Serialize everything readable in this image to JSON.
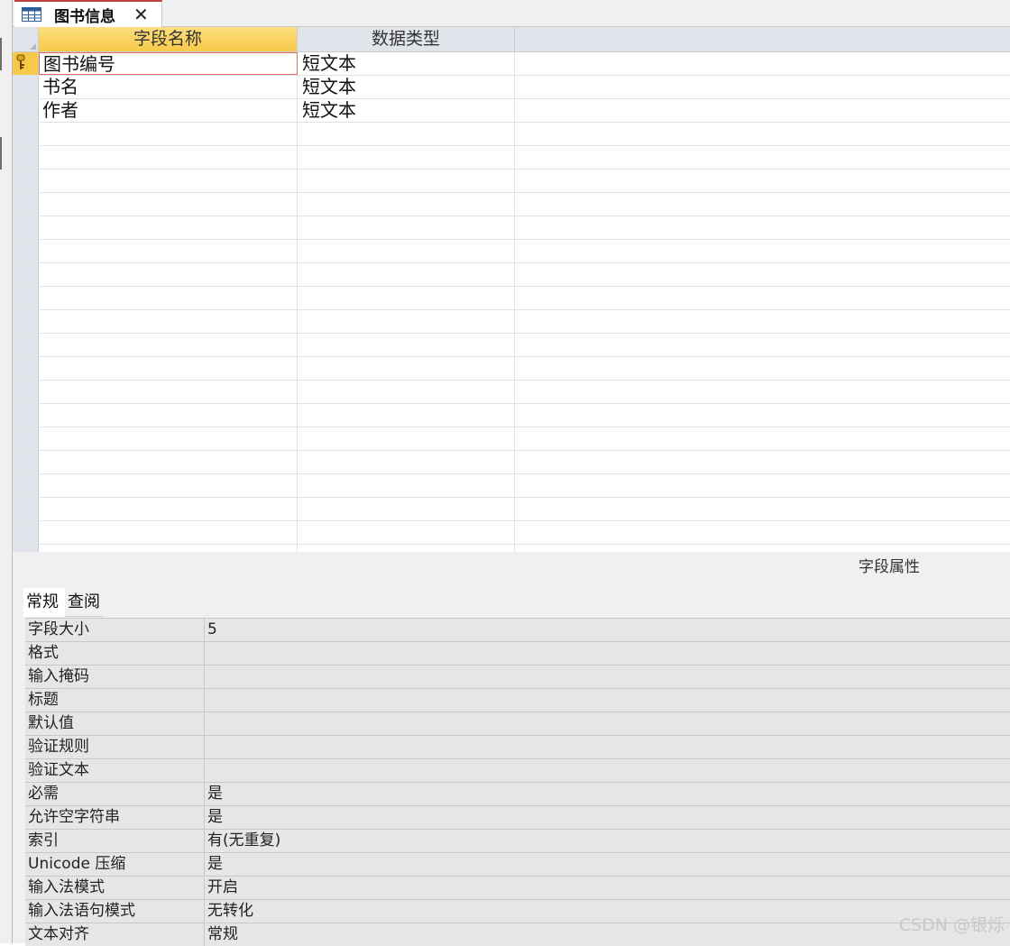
{
  "tab": {
    "title": "图书信息",
    "close_glyph": "✕"
  },
  "grid": {
    "headers": {
      "field_name": "字段名称",
      "data_type": "数据类型"
    },
    "rows": [
      {
        "name": "图书编号",
        "type": "短文本",
        "primary_key": true
      },
      {
        "name": "书名",
        "type": "短文本"
      },
      {
        "name": "作者",
        "type": "短文本"
      }
    ],
    "empty_row_count": 19
  },
  "field_properties": {
    "title": "字段属性",
    "tabs": [
      {
        "label": "常规",
        "active": true
      },
      {
        "label": "查阅",
        "active": false
      }
    ],
    "rows": [
      {
        "label": "字段大小",
        "value": "5"
      },
      {
        "label": "格式",
        "value": ""
      },
      {
        "label": "输入掩码",
        "value": ""
      },
      {
        "label": "标题",
        "value": ""
      },
      {
        "label": "默认值",
        "value": ""
      },
      {
        "label": "验证规则",
        "value": ""
      },
      {
        "label": "验证文本",
        "value": ""
      },
      {
        "label": "必需",
        "value": "是"
      },
      {
        "label": "允许空字符串",
        "value": "是"
      },
      {
        "label": "索引",
        "value": "有(无重复)"
      },
      {
        "label": "Unicode 压缩",
        "value": "是"
      },
      {
        "label": "输入法模式",
        "value": "开启"
      },
      {
        "label": "输入法语句模式",
        "value": "无转化"
      },
      {
        "label": "文本对齐",
        "value": "常规"
      }
    ]
  },
  "watermark": "CSDN @银烁",
  "colors": {
    "selected_header": "#f7c948",
    "active_tab_border": "#c43e3e",
    "focus_border": "#e46a6a"
  }
}
